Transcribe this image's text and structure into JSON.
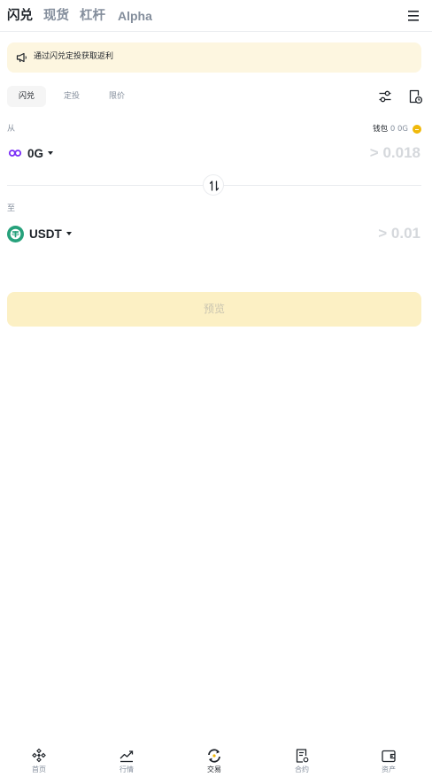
{
  "topnav": {
    "tabs": [
      {
        "label": "闪兑"
      },
      {
        "label": "现货"
      },
      {
        "label": "杠杆"
      },
      {
        "label": "Alpha"
      }
    ]
  },
  "banner": {
    "text": "通过闪兑定投获取返利"
  },
  "mode_tabs": [
    {
      "label": "闪兑"
    },
    {
      "label": "定投"
    },
    {
      "label": "限价"
    }
  ],
  "from": {
    "label": "从",
    "wallet_label": "钱包",
    "wallet_balance": "0 0G",
    "asset": "0G",
    "amount_placeholder": "> 0.018"
  },
  "to": {
    "label": "至",
    "asset": "USDT",
    "amount_placeholder": "> 0.01"
  },
  "preview_button": "预览",
  "bottomnav": [
    {
      "label": "首页"
    },
    {
      "label": "行情"
    },
    {
      "label": "交易"
    },
    {
      "label": "合约"
    },
    {
      "label": "资产"
    }
  ],
  "colors": {
    "accent_yellow": "#f0b90b",
    "banner_bg": "#fdf6e0",
    "preview_bg": "#fcf0c4",
    "og_purple": "#7b2ff7",
    "usdt_teal": "#26a17b"
  }
}
